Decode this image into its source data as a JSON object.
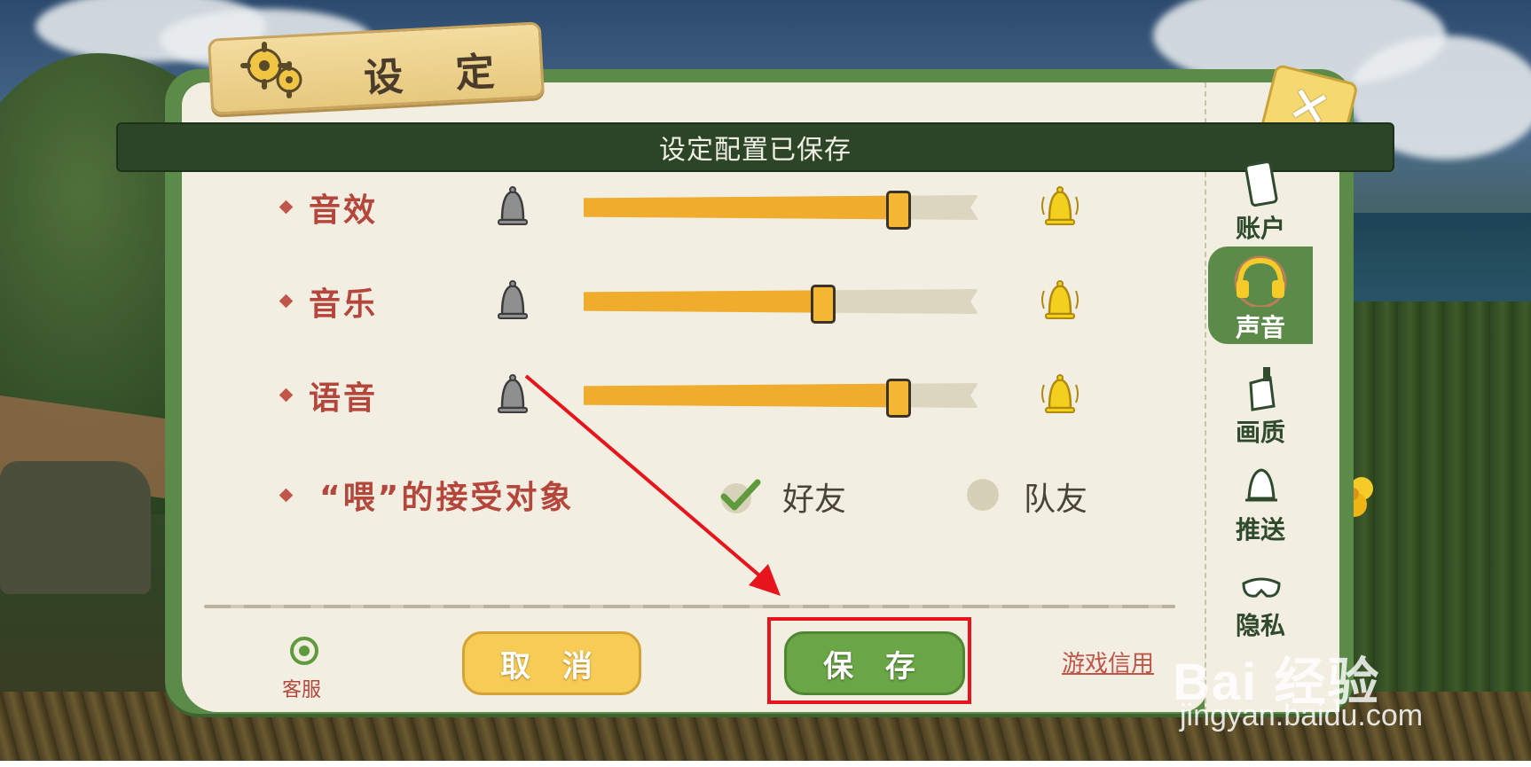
{
  "panel": {
    "title": "设 定",
    "banner_text": "设定配置已保存",
    "close_glyph": "✕"
  },
  "audio": {
    "rows": [
      {
        "label": "音效",
        "level_percent": 79
      },
      {
        "label": "音乐",
        "level_percent": 60
      },
      {
        "label": "语音",
        "level_percent": 79
      }
    ]
  },
  "hey_receiver": {
    "label": "“喂”的接受对象",
    "options": [
      {
        "label": "好友",
        "checked": true
      },
      {
        "label": "队友",
        "checked": false
      }
    ]
  },
  "footer": {
    "support_label": "客服",
    "cancel_label": "取 消",
    "save_label": "保 存",
    "credit_link": "游戏信用"
  },
  "side_nav": [
    {
      "label": "账户",
      "icon": "phone-icon",
      "active": false
    },
    {
      "label": "声音",
      "icon": "headphones-icon",
      "active": true
    },
    {
      "label": "画质",
      "icon": "paintbrush-icon",
      "active": false
    },
    {
      "label": "推送",
      "icon": "bell-icon",
      "active": false
    },
    {
      "label": "隐私",
      "icon": "mask-icon",
      "active": false
    }
  ],
  "watermark": {
    "brand": "Bai 经验",
    "url": "jingyan.baidu.com"
  },
  "colors": {
    "panel_green": "#5c8a48",
    "slider_fill": "#f0ac2c",
    "label_red": "#b4463c",
    "highlight_red": "#e8141c"
  }
}
